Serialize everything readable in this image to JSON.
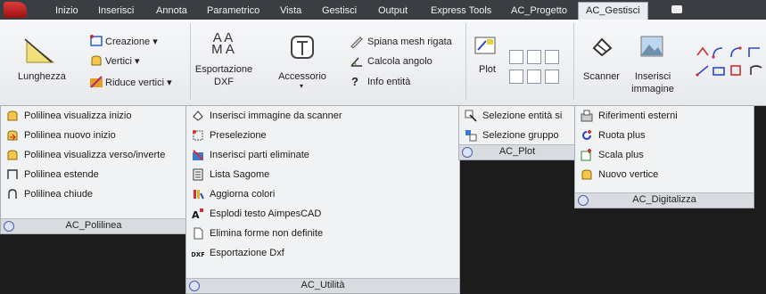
{
  "tabs": [
    "Inizio",
    "Inserisci",
    "Annota",
    "Parametrico",
    "Vista",
    "Gestisci",
    "Output",
    "Express Tools",
    "AC_Progetto",
    "AC_Gestisci"
  ],
  "ribbon": {
    "lunghezza": "Lunghezza",
    "creazione": "Creazione ▾",
    "vertici": "Vertici ▾",
    "riduce_vertici": "Riduce vertici ▾",
    "esportazione_big": "A A\nM A",
    "esportazione_l1": "Esportazione",
    "esportazione_l2": "DXF",
    "accessorio": "Accessorio",
    "spiana": "Spiana mesh rigata",
    "calcola": "Calcola angolo",
    "info": "Info entità",
    "plot": "Plot",
    "scanner": "Scanner",
    "inserisci_img_l1": "Inserisci",
    "inserisci_img_l2": "immagine"
  },
  "panels": {
    "polilinea": {
      "title": "AC_Polilinea",
      "items": [
        "Polilinea visualizza inizio",
        "Polilinea nuovo inizio",
        "Polilinea visualizza verso/inverte",
        "Polilinea estende",
        "Polilinea chiude"
      ]
    },
    "utilita": {
      "title": "AC_Utilità",
      "items": [
        "Inserisci immagine da scanner",
        "Preselezione",
        "Inserisci parti eliminate",
        "Lista Sagome",
        "Aggiorna colori",
        "Esplodi testo AimpesCAD",
        "Elimina forme non definite",
        "Esportazione Dxf"
      ]
    },
    "plot": {
      "title": "AC_Plot",
      "items": [
        "Selezione entità si",
        "Selezione gruppo"
      ]
    },
    "digitalizza": {
      "title": "AC_Digitalizza",
      "items": [
        "Riferimenti esterni",
        "Ruota plus",
        "Scala plus",
        "Nuovo vertice"
      ]
    }
  }
}
